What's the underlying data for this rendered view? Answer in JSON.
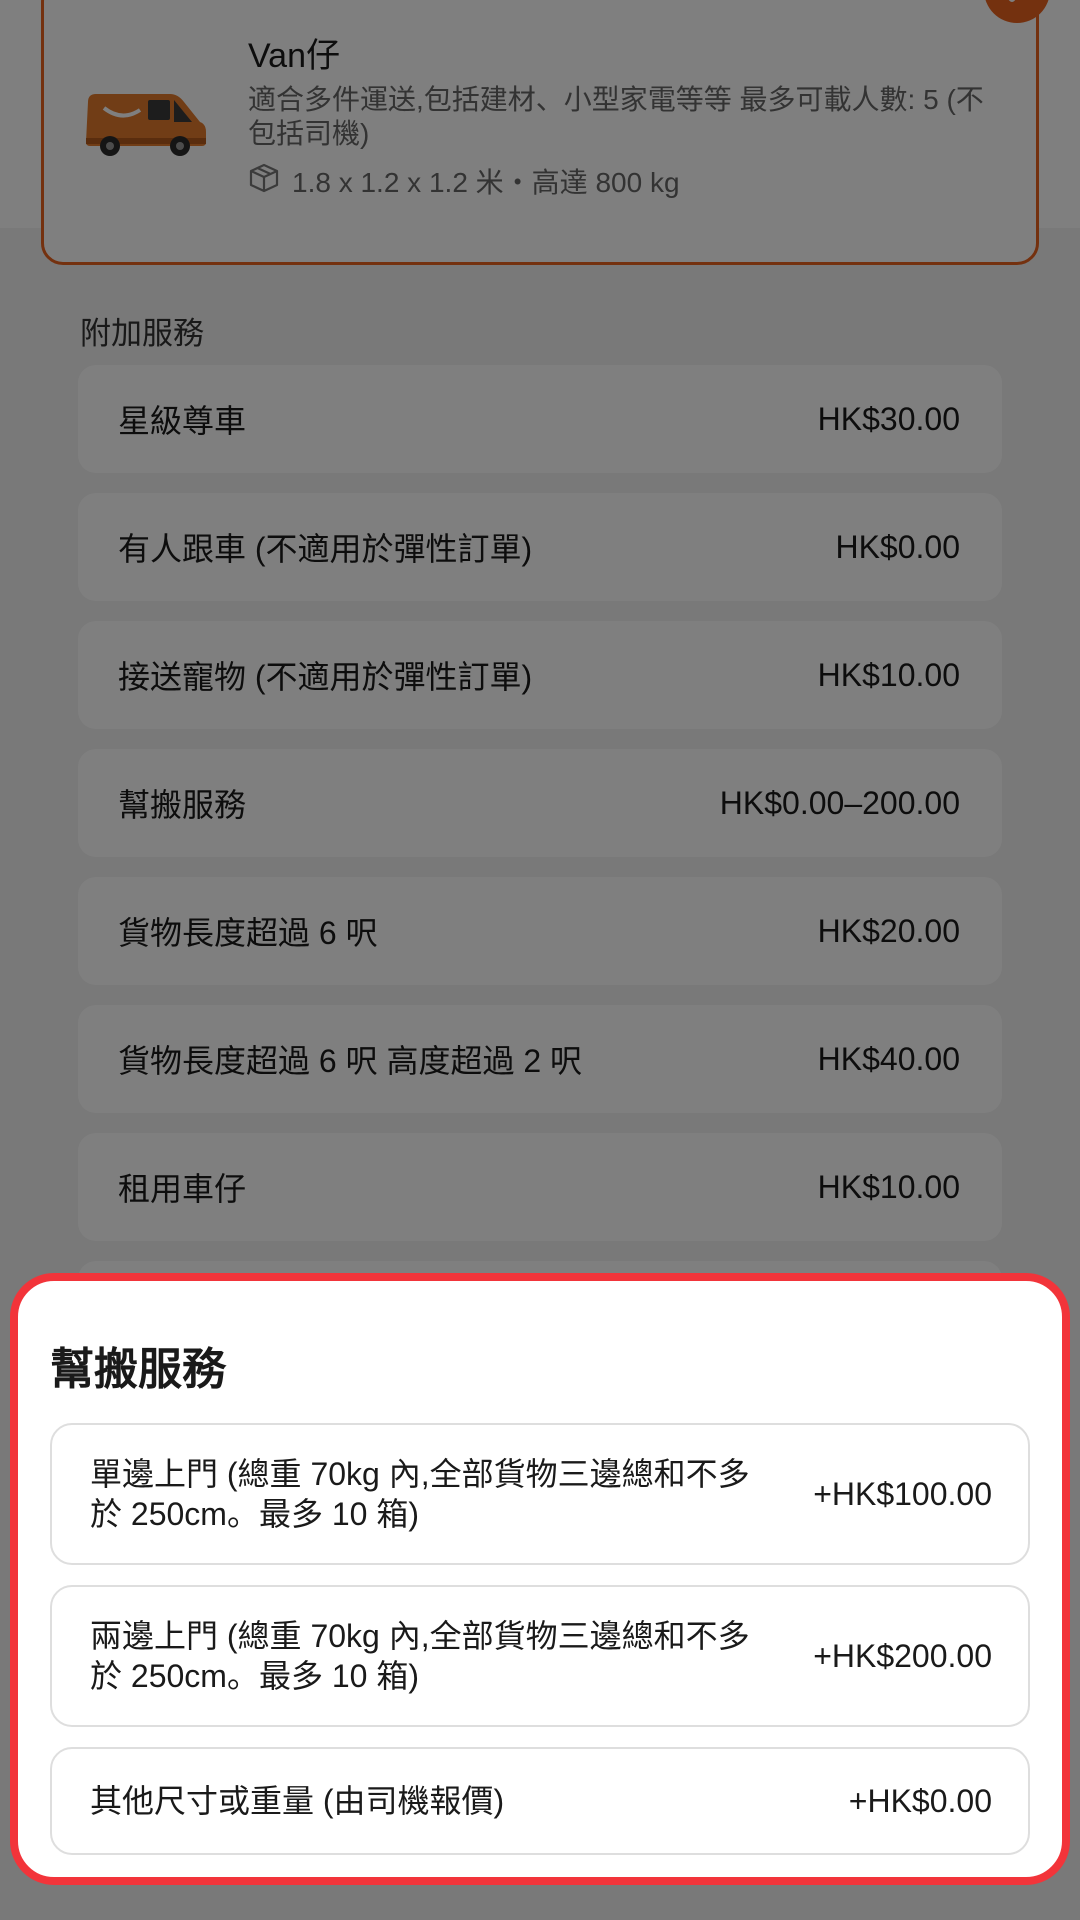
{
  "vehicle": {
    "name": "Van仔",
    "description": "適合多件運送,包括建材、小型家電等等 最多可載人數: 5 (不包括司機)",
    "spec": "1.8 x 1.2 x 1.2 米・高達 800 kg",
    "accent_color": "#e8631f"
  },
  "additional_services": {
    "label": "附加服務",
    "items": [
      {
        "name": "星級尊車",
        "price": "HK$30.00"
      },
      {
        "name": "有人跟車 (不適用於彈性訂單)",
        "price": "HK$0.00"
      },
      {
        "name": "接送寵物 (不適用於彈性訂單)",
        "price": "HK$10.00"
      },
      {
        "name": "幫搬服務",
        "price": "HK$0.00–200.00"
      },
      {
        "name": "貨物長度超過 6 呎",
        "price": "HK$20.00"
      },
      {
        "name": "貨物長度超過 6 呎 高度超過 2 呎",
        "price": "HK$40.00"
      },
      {
        "name": "租用車仔",
        "price": "HK$10.00"
      }
    ]
  },
  "sheet": {
    "title": "幫搬服務",
    "highlight_color": "#f2343a",
    "options": [
      {
        "label": "單邊上門 (總重 70kg 內,全部貨物三邊總和不多於 250cm。最多 10 箱)",
        "price": "+HK$100.00"
      },
      {
        "label": "兩邊上門 (總重 70kg 內,全部貨物三邊總和不多於 250cm。最多 10 箱)",
        "price": "+HK$200.00"
      },
      {
        "label": "其他尺寸或重量 (由司機報價)",
        "price": "+HK$0.00"
      }
    ]
  }
}
